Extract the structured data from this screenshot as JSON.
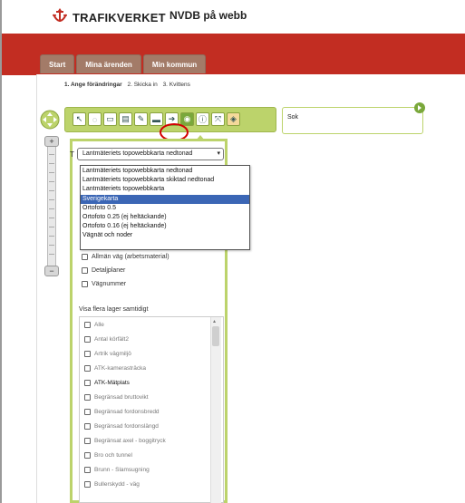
{
  "header": {
    "brand": "TRAFIKVERKET",
    "app_title": "NVDB på webb"
  },
  "tabs": [
    {
      "label": "Start"
    },
    {
      "label": "Mina ärenden"
    },
    {
      "label": "Min kommun"
    }
  ],
  "steps": [
    {
      "label": "1. Ange förändringar"
    },
    {
      "label": "2. Skicka in"
    },
    {
      "label": "3. Kvittens"
    }
  ],
  "toolbar": {
    "icons": [
      "pointer-icon",
      "measure-icon",
      "print-icon",
      "save-icon",
      "draw-icon",
      "layers-icon",
      "arrow-icon",
      "target-icon",
      "info-icon",
      "fullscreen-icon",
      "gps-icon"
    ]
  },
  "search": {
    "label": "Sok"
  },
  "layer_panel": {
    "t_letter": "T",
    "select_value": "Lantmäteriets topowebbkarta nedtonad",
    "dropdown_options": [
      {
        "label": "Lantmäteriets topowebbkarta nedtonad",
        "selected": false
      },
      {
        "label": "Lantmäteriets topowebbkarta skiktad nedtonad",
        "selected": false
      },
      {
        "label": "Lantmäteriets topowebbkarta",
        "selected": false
      },
      {
        "label": "Sverigekarta",
        "selected": true
      },
      {
        "label": "Ortofoto 0.5",
        "selected": false
      },
      {
        "label": "Ortofoto 0.25 (ej heltäckande)",
        "selected": false
      },
      {
        "label": "Ortofoto 0.16 (ej heltäckande)",
        "selected": false
      },
      {
        "label": "Vägnät och noder",
        "selected": false
      }
    ],
    "checkboxes": [
      {
        "label": "Allmän väg (arbetsmaterial)"
      },
      {
        "label": "Detaljplaner"
      },
      {
        "label": "Vägnummer"
      }
    ],
    "multi_title": "Visa flera lager samtidigt",
    "layers": [
      {
        "label": "Alle"
      },
      {
        "label": "Antal körfält2"
      },
      {
        "label": "Artrik vägmiljö"
      },
      {
        "label": "ATK-kamerasträcka"
      },
      {
        "label": "ATK-Mätplats"
      },
      {
        "label": "Begränsad bruttovikt"
      },
      {
        "label": "Begränsad fordonsbredd"
      },
      {
        "label": "Begränsad fordonslängd"
      },
      {
        "label": "Begränsat axel - boggitryck"
      },
      {
        "label": "Bro och tunnel"
      },
      {
        "label": "Brunn - Slamsugning"
      },
      {
        "label": "Bullerskydd - väg"
      }
    ]
  },
  "colors": {
    "brand_red": "#c22d22",
    "toolbar_green": "#bcd36b",
    "tab_brown": "#a37b68",
    "selection_blue": "#3b66b5",
    "highlight_red": "#d30000"
  }
}
